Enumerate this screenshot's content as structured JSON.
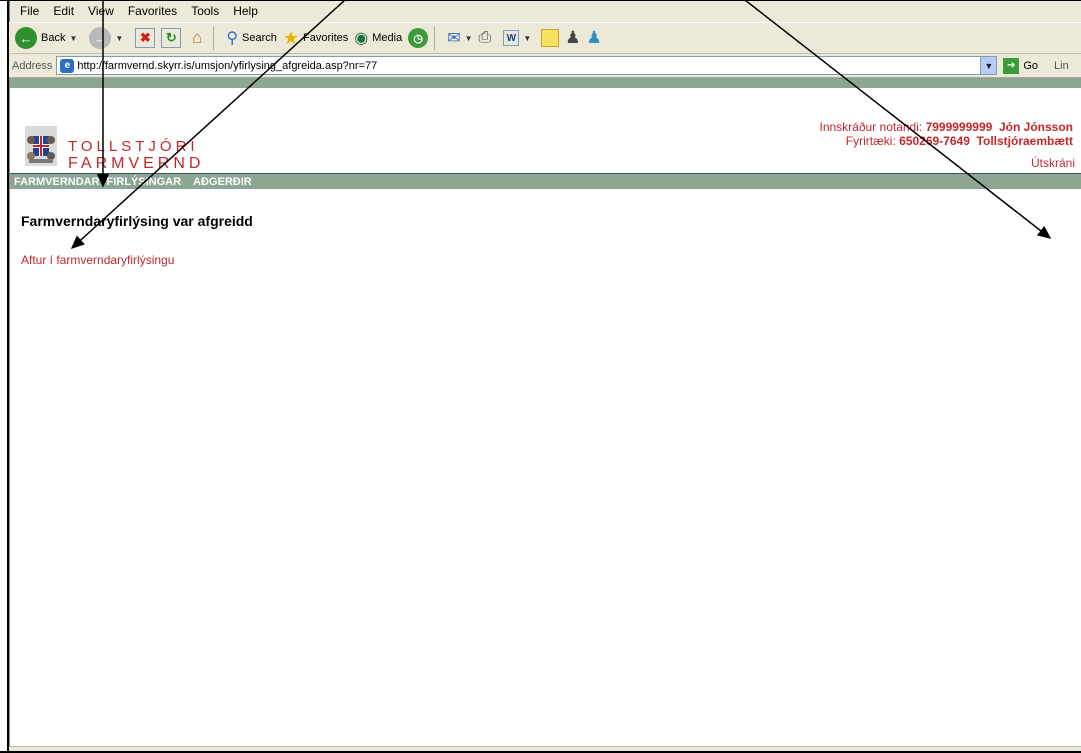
{
  "menu": [
    "File",
    "Edit",
    "View",
    "Favorites",
    "Tools",
    "Help"
  ],
  "toolbar": {
    "back_label": "Back",
    "search_label": "Search",
    "favorites_label": "Favorites",
    "media_label": "Media"
  },
  "address": {
    "label": "Address",
    "url": "http://farmvernd.skyrr.is/umsjon/yfirlysing_afgreida.asp?nr=77",
    "go_label": "Go",
    "links_label": "Lin"
  },
  "site": {
    "logo_top": "TOLLSTJÓRI",
    "logo_bottom": "FARMVERND",
    "user_label": "Innskráður notandi:",
    "user_id": "7999999999",
    "user_name": "Jón Jónsson",
    "company_label": "Fyrirtæki:",
    "company_id": "650269-7649",
    "company_name": "Tollstjóraembætt",
    "logout": "Útskráni"
  },
  "nav": [
    "FARMVERNDARYFIRLÝSINGAR",
    "AÐGERÐIR"
  ],
  "content": {
    "heading": "Farmverndaryfirlýsing var afgreidd",
    "back_link": "Aftur í farmverndaryfirlýsingu"
  },
  "colors": {
    "accent_red": "#c0282c",
    "nav_green": "#8da692"
  }
}
